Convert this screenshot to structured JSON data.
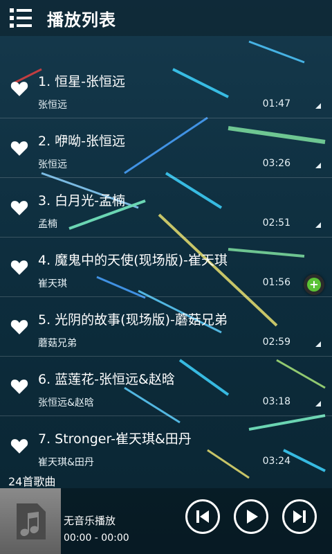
{
  "header": {
    "title": "播放列表",
    "menu_icon": "list-menu-icon"
  },
  "songs": [
    {
      "title": "1. 恒星-张恒远",
      "artist": "张恒远",
      "duration": "01:47"
    },
    {
      "title": "2. 咿呦-张恒远",
      "artist": "张恒远",
      "duration": "03:26"
    },
    {
      "title": "3. 白月光-孟楠",
      "artist": "孟楠",
      "duration": "02:51"
    },
    {
      "title": "4. 魔鬼中的天使(现场版)-崔天琪",
      "artist": "崔天琪",
      "duration": "01:56"
    },
    {
      "title": "5. 光阴的故事(现场版)-蘑菇兄弟",
      "artist": "蘑菇兄弟",
      "duration": "02:59"
    },
    {
      "title": "6. 蓝莲花-张恒远&赵晗",
      "artist": "张恒远&赵晗",
      "duration": "03:18"
    },
    {
      "title": "7. Stronger-崔天琪&田丹",
      "artist": "崔天琪&田丹",
      "duration": "03:24"
    }
  ],
  "footer": {
    "song_count": "24首歌曲"
  },
  "player": {
    "now_playing": "无音乐播放",
    "time": "00:00 - 00:00"
  },
  "colors": {
    "accent_green": "#5bc236",
    "background": "#0b2a3a"
  }
}
